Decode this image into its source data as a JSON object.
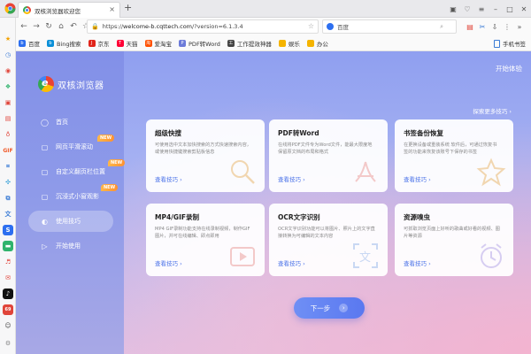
{
  "window": {
    "tab_title": "双核浏览器欢迎您",
    "new_tab": "+",
    "close": "×"
  },
  "address": {
    "url_prefix": "https://",
    "url_host": "welcome-b.cqttech.com",
    "url_path": "/?version=6.1.3.4",
    "search_text": "百度"
  },
  "bookmarks": [
    {
      "label": "百度",
      "color": "#2d6ff0",
      "glyph": "b"
    },
    {
      "label": "Bing搜索",
      "color": "#0a8fd8",
      "glyph": "b"
    },
    {
      "label": "京东",
      "color": "#e1251b",
      "glyph": "J"
    },
    {
      "label": "天猫",
      "color": "#ff0036",
      "glyph": "T"
    },
    {
      "label": "爱淘宝",
      "color": "#ff5000",
      "glyph": "淘"
    },
    {
      "label": "PDF转Word",
      "color": "#6c7bd9",
      "glyph": "P"
    },
    {
      "label": "工作提效神器",
      "color": "#444444",
      "glyph": "工"
    },
    {
      "label": "娱乐",
      "color": "#f5b400",
      "glyph": ""
    },
    {
      "label": "办公",
      "color": "#f5b400",
      "glyph": ""
    }
  ],
  "mobile_bookmarks": "手机书签",
  "brand": {
    "name": "双核浏览器"
  },
  "menu": [
    {
      "label": "首页",
      "icon": "circle-icon",
      "badge": ""
    },
    {
      "label": "网页平滑滚动",
      "icon": "page-icon",
      "badge": "NEW"
    },
    {
      "label": "自定义翻页栏位置",
      "icon": "page-icon",
      "badge": "NEW"
    },
    {
      "label": "沉浸式小窗观影",
      "icon": "page-icon",
      "badge": "NEW"
    },
    {
      "label": "使用技巧",
      "icon": "tips-icon",
      "badge": ""
    },
    {
      "label": "开始使用",
      "icon": "play-icon",
      "badge": ""
    }
  ],
  "header": {
    "start_experience": "开始体验",
    "explore_more": "探索更多技巧 ›"
  },
  "cards": [
    {
      "title": "超级快搜",
      "desc": "可使用选中文本加快搜索的方式快速搜索内容，或使用快捷键搜索剪贴板信息",
      "link": "查看技巧 ›",
      "deco": "search"
    },
    {
      "title": "PDF转Word",
      "desc": "在线将PDF文件专为Word文件，能最大限度地保留原文档的布局和格式",
      "link": "查看技巧 ›",
      "deco": "pdf"
    },
    {
      "title": "书签备份恢复",
      "desc": "在更换设备或重装系统 软件后，可通过恢复书签的功能来恢复该账号下保存的书签",
      "link": "查看技巧 ›",
      "deco": "star"
    },
    {
      "title": "MP4/GIF录制",
      "desc": "MP4 GIF录制功能支持在线录制视频，制作GIF图片，并可在线编辑、即点即用",
      "link": "查看技巧 ›",
      "deco": "video"
    },
    {
      "title": "OCR文字识别",
      "desc": "OCR文字识别功能可以将图片、照片上的文字直接转换为可编辑的文本内容",
      "link": "查看技巧 ›",
      "deco": "ocr"
    },
    {
      "title": "资源嗅虫",
      "desc": "可抓取浏览页面上好听的歌曲或好看的视频、图片等资源",
      "link": "查看技巧 ›",
      "deco": "clock"
    }
  ],
  "next_button": "下一步",
  "colors": {
    "accent": "#4a72e8",
    "panel": "#8290e8",
    "button": "#5a78f0"
  }
}
